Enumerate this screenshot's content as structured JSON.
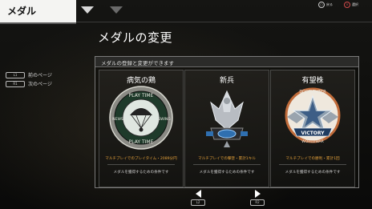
{
  "header": {
    "tab_label": "メダル",
    "hint_back_glyph": "○",
    "hint_back_label": "戻る",
    "hint_select_glyph": "×",
    "hint_select_label": "選択"
  },
  "title": "メダルの変更",
  "side": {
    "prev_key": "L1",
    "prev_label": "前のページ",
    "next_key": "R1",
    "next_label": "次のページ"
  },
  "panel": {
    "header": "メダルの登録と変更ができます"
  },
  "cards": [
    {
      "name": "病気の鶏",
      "medal_top": "PLAY TIME",
      "medal_bottom": "PLAY TIME",
      "medal_left": "NEWS",
      "medal_right": "SWING",
      "condition": "マルチプレイでのプレイタイム・2089分円",
      "desc": "メダルを獲得するための条件です"
    },
    {
      "name": "新兵",
      "condition": "マルチプレイでの撃墜・累計1キル",
      "desc": "メダルを獲得するための条件です"
    },
    {
      "name": "有望株",
      "medal_top": "DOGFIGHTER",
      "medal_banner": "VICTORY",
      "medal_bottom": "WORLDWAR",
      "condition": "マルチプレイでの勝利・累計1回",
      "desc": "メダルを獲得するための条件です"
    }
  ],
  "pager": {
    "left_key": "L2",
    "right_key": "R2"
  },
  "colors": {
    "accent": "#e5a23a",
    "panel_border": "#7a7a7a"
  }
}
